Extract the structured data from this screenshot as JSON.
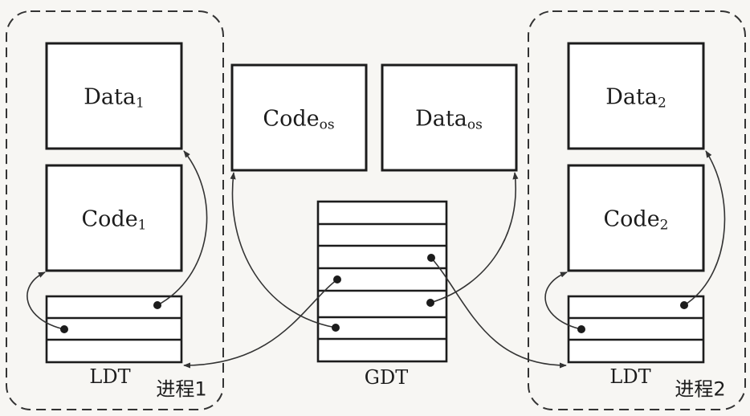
{
  "process1": {
    "label": "进程1",
    "data_box": {
      "base": "Data",
      "sub": "1"
    },
    "code_box": {
      "base": "Code",
      "sub": "1"
    },
    "table_label": "LDT"
  },
  "process2": {
    "label": "进程2",
    "data_box": {
      "base": "Data",
      "sub": "2"
    },
    "code_box": {
      "base": "Code",
      "sub": "2"
    },
    "table_label": "LDT"
  },
  "os": {
    "code_box": {
      "base": "Code",
      "sub": "os"
    },
    "data_box": {
      "base": "Data",
      "sub": "os"
    }
  },
  "gdt": {
    "label": "GDT"
  }
}
